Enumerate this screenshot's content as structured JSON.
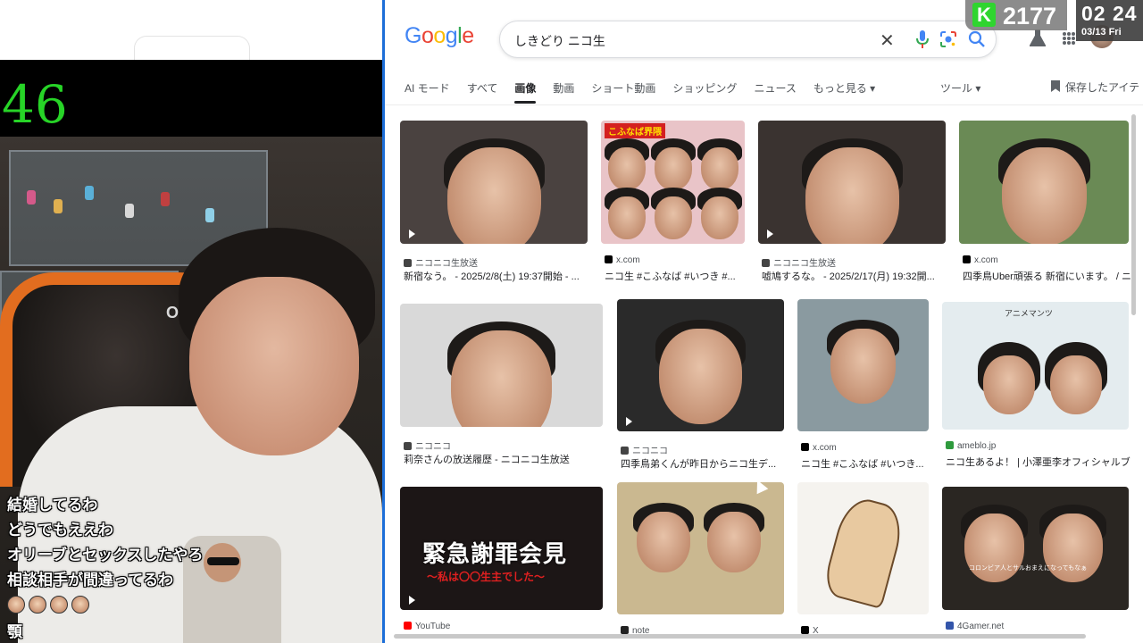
{
  "stream": {
    "counter": "46",
    "chair_logo": "OITA",
    "comments": [
      "結婚してるわ",
      "どうでもええわ",
      "オリーブとセックスしたやろ",
      "相談相手が間違ってるわ"
    ],
    "last_comment": "顎"
  },
  "overlay": {
    "k_logo": "K",
    "k_count": "2177",
    "clock_time": "02 24",
    "clock_date": "03/13 Fri"
  },
  "google": {
    "logo_letters": [
      {
        "ch": "G",
        "color": "#4285F4"
      },
      {
        "ch": "o",
        "color": "#EA4335"
      },
      {
        "ch": "o",
        "color": "#FBBC05"
      },
      {
        "ch": "g",
        "color": "#4285F4"
      },
      {
        "ch": "l",
        "color": "#34A853"
      },
      {
        "ch": "e",
        "color": "#EA4335"
      }
    ],
    "query": "しきどり ニコ生",
    "clear_glyph": "✕",
    "tabs": [
      "AI モード",
      "すべて",
      "画像",
      "動画",
      "ショート動画",
      "ショッピング",
      "ニュース",
      "もっと見る ▾"
    ],
    "active_tab": "画像",
    "tools": "ツール ▾",
    "saved": "保存したアイテ"
  },
  "results": [
    {
      "source": "ニコニコ生放送",
      "source_color": "#444444",
      "caption": "新宿なう。 - 2025/2/8(土) 19:37開始 - ...",
      "video": true
    },
    {
      "source": "x.com",
      "source_color": "#000000",
      "caption": "ニコ生 #こふなば #いつき #...",
      "video": false,
      "banner": "こふなば界隈"
    },
    {
      "source": "ニコニコ生放送",
      "source_color": "#444444",
      "caption": "嘘鳩するな。 - 2025/2/17(月) 19:32開...",
      "video": true
    },
    {
      "source": "x.com",
      "source_color": "#000000",
      "caption": "四季鳥Uber頑張る 新宿にいます。 / ニ",
      "video": false
    },
    {
      "source": "ニコニコ",
      "source_color": "#444444",
      "caption": "莉奈さんの放送履歴 - ニコニコ生放送",
      "video": false
    },
    {
      "source": "ニコニコ",
      "source_color": "#444444",
      "caption": "四季鳥弟くんが昨日からニコ生デ...",
      "video": true
    },
    {
      "source": "x.com",
      "source_color": "#000000",
      "caption": "ニコ生 #こふなば #いつき...",
      "video": false
    },
    {
      "source": "ameblo.jp",
      "source_color": "#2e9a3d",
      "caption": "ニコ生あるよ！ | 小澤亜李オフィシャルブ",
      "video": false,
      "anime_text": "アニメマンツ"
    },
    {
      "source": "YouTube",
      "source_color": "#ff0000",
      "caption": "",
      "video": true,
      "overlay_text": "緊急謝罪会見",
      "sub_text": "〜私は〇〇生主でした〜"
    },
    {
      "source": "note",
      "source_color": "#222222",
      "caption": "",
      "video": false
    },
    {
      "source": "X",
      "source_color": "#000000",
      "caption": "",
      "video": false
    },
    {
      "source": "4Gamer.net",
      "source_color": "#3355aa",
      "caption": "",
      "video": false,
      "overlay_text": "コロンビア人とサルおまえになってもなぁ"
    }
  ]
}
